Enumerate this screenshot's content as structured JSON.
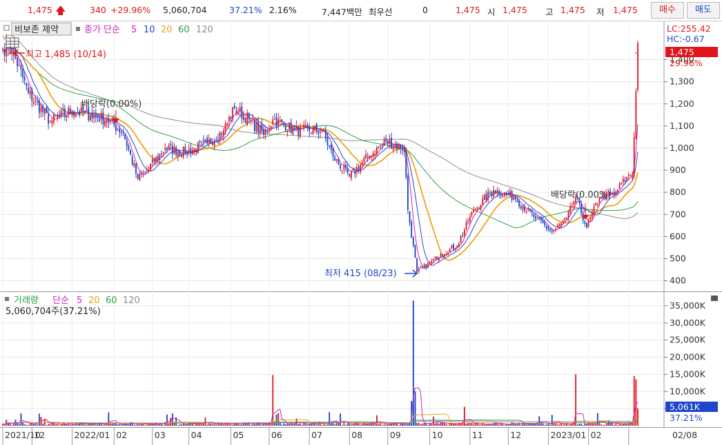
{
  "quote": {
    "price": "1,475",
    "change": "340",
    "change_pct": "+29.96%",
    "volume": "5,060,704",
    "volume_ratio": "37.21%",
    "turnover": "2.16%",
    "amount": "7,447백만",
    "prior_label": "최우선",
    "prior_value": "0",
    "prior_price": "1,475",
    "open_label": "시",
    "open": "1,475",
    "high_label": "고",
    "high": "1,475",
    "low_label": "저",
    "low": "1,475",
    "buy_label": "매수",
    "sell_label": "매도"
  },
  "price_panel": {
    "legend_tag": "비보존 제약",
    "legend_series_label": "종가 단순",
    "legend_periods": [
      "5",
      "10",
      "20",
      "60",
      "120"
    ],
    "lc_label": "LC:255.42",
    "hc_label": "HC:-0.67",
    "current_price": "1,475",
    "current_pct": "29.96%",
    "high_annotation": "최고 1,485 (10/14)",
    "low_annotation": "최저 415 (08/23)",
    "dividend_label_1": "배당락(0.00%)",
    "dividend_label_2": "배당락(0.00%)"
  },
  "volume_panel": {
    "legend_tag": "거래량",
    "legend_series_label": "단순",
    "legend_periods": [
      "5",
      "20",
      "60",
      "120"
    ],
    "info": "5,060,704주(37.21%)",
    "current_volume": "5,061K",
    "current_pct": "37.21%"
  },
  "colors": {
    "up": "#e0161b",
    "down": "#1646c8",
    "ma5": "#d21fbf",
    "ma10": "#1f46c8",
    "ma20": "#f0a318",
    "ma60": "#2aa242",
    "ma120": "#8c8c8c"
  },
  "chart_data": [
    {
      "type": "candlestick",
      "title": "비보존 제약",
      "ylim": [
        355,
        1570
      ],
      "y_ticks": [
        400,
        500,
        600,
        700,
        800,
        900,
        1000,
        1100,
        1200,
        1300,
        1400
      ],
      "x_tick_labels": [
        "2021/10",
        "12",
        "2022/01",
        "02",
        "03",
        "04",
        "05",
        "06",
        "07",
        "08",
        "09",
        "10",
        "11",
        "12",
        "2023/01",
        "02",
        "02/08"
      ],
      "anchors": [
        {
          "date": "2021/10/08",
          "close": 1450
        },
        {
          "date": "2021/10/14",
          "close": 1470
        },
        {
          "date": "2021/10/28",
          "close": 1250
        },
        {
          "date": "2021/11/15",
          "close": 1120
        },
        {
          "date": "2021/12/01",
          "close": 1170
        },
        {
          "date": "2021/12/15",
          "close": 1150
        },
        {
          "date": "2021/12/28",
          "close": 1130
        },
        {
          "date": "2022/01/10",
          "close": 1070
        },
        {
          "date": "2022/01/20",
          "close": 860
        },
        {
          "date": "2022/01/27",
          "close": 900
        },
        {
          "date": "2022/02/10",
          "close": 1000
        },
        {
          "date": "2022/02/25",
          "close": 980
        },
        {
          "date": "2022/03/15",
          "close": 1020
        },
        {
          "date": "2022/03/28",
          "close": 1080
        },
        {
          "date": "2022/04/05",
          "close": 1180
        },
        {
          "date": "2022/04/15",
          "close": 1130
        },
        {
          "date": "2022/04/27",
          "close": 1060
        },
        {
          "date": "2022/05/04",
          "close": 1130
        },
        {
          "date": "2022/05/20",
          "close": 1080
        },
        {
          "date": "2022/06/10",
          "close": 1080
        },
        {
          "date": "2022/06/20",
          "close": 960
        },
        {
          "date": "2022/07/01",
          "close": 870
        },
        {
          "date": "2022/07/15",
          "close": 960
        },
        {
          "date": "2022/07/29",
          "close": 1030
        },
        {
          "date": "2022/08/12",
          "close": 1000
        },
        {
          "date": "2022/08/16",
          "close": 720
        },
        {
          "date": "2022/08/23",
          "close": 440
        },
        {
          "date": "2022/09/01",
          "close": 480
        },
        {
          "date": "2022/09/10",
          "close": 520
        },
        {
          "date": "2022/09/22",
          "close": 560
        },
        {
          "date": "2022/10/05",
          "close": 720
        },
        {
          "date": "2022/10/20",
          "close": 810
        },
        {
          "date": "2022/11/05",
          "close": 780
        },
        {
          "date": "2022/11/20",
          "close": 690
        },
        {
          "date": "2022/12/05",
          "close": 620
        },
        {
          "date": "2022/12/15",
          "close": 680
        },
        {
          "date": "2022/12/22",
          "close": 780
        },
        {
          "date": "2022/12/30",
          "close": 640
        },
        {
          "date": "2023/01/10",
          "close": 780
        },
        {
          "date": "2023/01/20",
          "close": 790
        },
        {
          "date": "2023/01/31",
          "close": 870
        },
        {
          "date": "2023/02/03",
          "close": 880
        },
        {
          "date": "2023/02/06",
          "close": 1050
        },
        {
          "date": "2023/02/08",
          "close": 1475
        }
      ]
    },
    {
      "type": "bar",
      "title": "거래량",
      "ylim": [
        0,
        39000
      ],
      "y_ticks": [
        5000,
        10000,
        15000,
        20000,
        25000,
        30000,
        35000
      ],
      "y_tick_labels": [
        "",
        "10,000K",
        "15,000K",
        "20,000K",
        "25,000K",
        "30,000K",
        "35,000K"
      ],
      "spikes_k": [
        {
          "date": "2022/05/04",
          "value": 14800
        },
        {
          "date": "2022/08/19",
          "value": 36500
        },
        {
          "date": "2022/08/22",
          "value": 10000
        },
        {
          "date": "2022/08/18",
          "value": 7200
        },
        {
          "date": "2022/09/28",
          "value": 5500
        },
        {
          "date": "2022/12/22",
          "value": 15000
        },
        {
          "date": "2023/02/06",
          "value": 14500
        },
        {
          "date": "2023/02/07",
          "value": 13500
        },
        {
          "date": "2023/02/08",
          "value": 5061
        }
      ]
    }
  ]
}
